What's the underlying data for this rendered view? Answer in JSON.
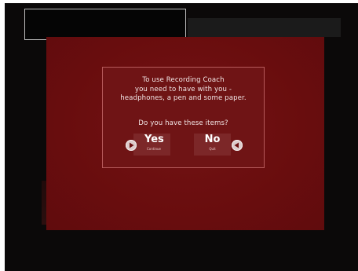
{
  "window": {
    "title_box_text": "",
    "title_strip_text": ""
  },
  "dialog": {
    "line1": "To use Recording Coach",
    "line2": "you need to have with you -",
    "line3": "headphones, a pen and some paper.",
    "question": "Do you have these items?"
  },
  "buttons": {
    "yes": {
      "label": "Yes",
      "sublabel": "Continue",
      "icon": "arrow-right-icon"
    },
    "no": {
      "label": "No",
      "sublabel": "Quit",
      "icon": "arrow-left-icon"
    }
  },
  "colors": {
    "canvas": "#6b0e0f",
    "dialog_border": "#b65a5b",
    "button_bg": "#7c2728",
    "text": "#f1e4e4"
  }
}
